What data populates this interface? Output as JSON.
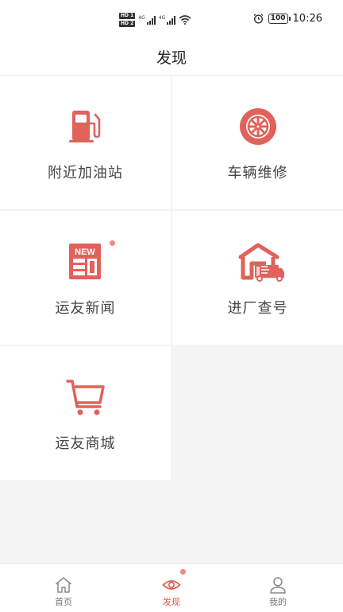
{
  "status_bar": {
    "sim_badges": [
      "HD",
      "HD"
    ],
    "sim_numbers": [
      "1",
      "2"
    ],
    "network": [
      "4G",
      "4G"
    ],
    "battery": "100",
    "time": "10:26"
  },
  "header": {
    "title": "发现"
  },
  "grid": {
    "items": [
      {
        "label": "附近加油站",
        "icon": "gas-station-icon"
      },
      {
        "label": "车辆维修",
        "icon": "wheel-icon"
      },
      {
        "label": "运友新闻",
        "icon": "news-icon",
        "icon_text": "NEW",
        "has_dot": true
      },
      {
        "label": "进厂查号",
        "icon": "warehouse-truck-icon"
      },
      {
        "label": "运友商城",
        "icon": "shopping-cart-icon"
      }
    ]
  },
  "tabbar": {
    "tabs": [
      {
        "label": "首页",
        "icon": "home-icon",
        "active": false
      },
      {
        "label": "发现",
        "icon": "eye-icon",
        "active": true,
        "has_dot": true
      },
      {
        "label": "我的",
        "icon": "user-icon",
        "active": false
      }
    ]
  },
  "colors": {
    "accent": "#e2574c",
    "icon": "#e0625a",
    "dot": "#ec8a83",
    "background": "#f4f4f4"
  }
}
